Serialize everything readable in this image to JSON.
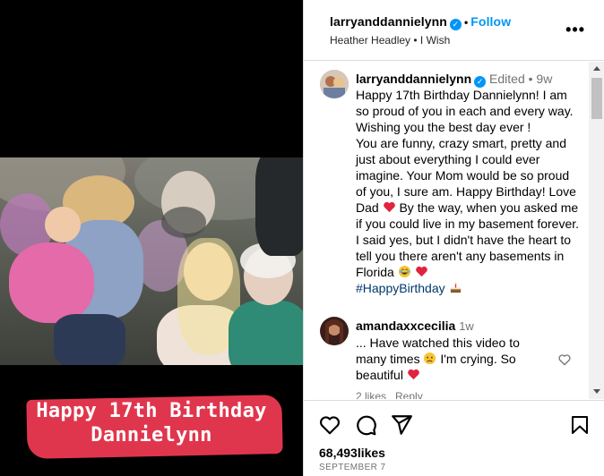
{
  "post": {
    "username": "larryanddannielynn",
    "follow_label": "Follow",
    "audio": "Heather Headley • I Wish",
    "more_icon": "more-horizontal-icon",
    "banner_line1": "Happy 17th Birthday",
    "banner_line2": "Dannielynn",
    "likes": "68,493likes",
    "date": "SEPTEMBER 7"
  },
  "caption": {
    "username": "larryanddannielynn",
    "meta": "Edited • 9w",
    "text1": "Happy 17th Birthday Dannielynn! I am so proud of you in each and every way. Wishing you the best day ever !",
    "text2": "You are funny, crazy smart, pretty and just about everything I could ever imagine. Your Mom would be so proud of you, I sure am. Happy Birthday! Love Dad",
    "text3": "By the way, when you asked me if you could live in my basement forever. I said yes, but I didn't have the heart to tell you there aren't any basements in Florida",
    "hashtag": "#HappyBirthday"
  },
  "comment": {
    "username": "amandaxxcecilia",
    "time": "1w",
    "text1": "... Have watched this video to many times",
    "text2": "I'm crying. So beautiful",
    "likes_label": "2 likes",
    "reply_label": "Reply"
  },
  "icons": {
    "like": "heart-icon",
    "comment": "comment-icon",
    "share": "share-icon",
    "save": "bookmark-icon"
  },
  "colors": {
    "accent": "#0095f6",
    "banner": "#e0364d",
    "hashtag": "#00376b",
    "meta": "#737373"
  }
}
